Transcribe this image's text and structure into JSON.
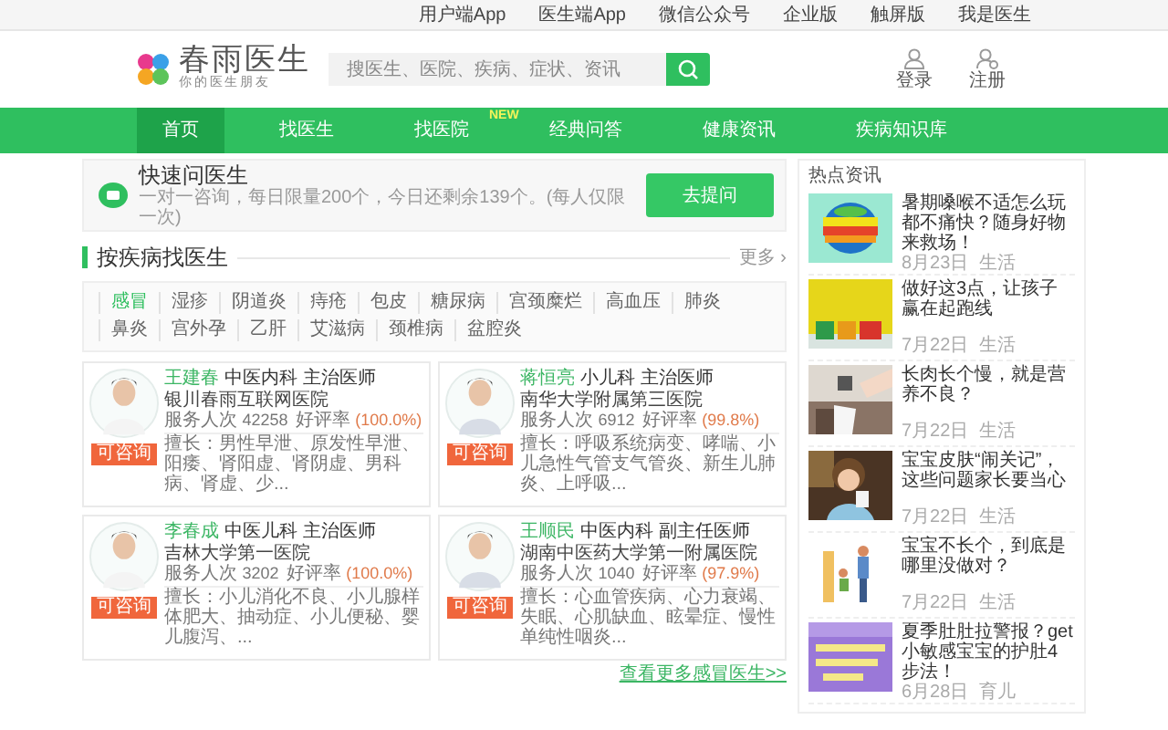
{
  "top_links": [
    "用户端App",
    "医生端App",
    "微信公众号",
    "企业版",
    "触屏版",
    "我是医生"
  ],
  "logo": {
    "name": "春雨医生",
    "tagline": "你的医生朋友"
  },
  "search": {
    "placeholder": "搜医生、医院、疾病、症状、资讯"
  },
  "user_links": [
    {
      "kind": "login",
      "label": "登录"
    },
    {
      "kind": "register",
      "label": "注册"
    }
  ],
  "nav": [
    {
      "label": "首页",
      "selected": true
    },
    {
      "label": "找医生",
      "selected": false
    },
    {
      "label": "找医院",
      "selected": false,
      "badge": "NEW"
    },
    {
      "label": "经典问答",
      "selected": false
    },
    {
      "label": "健康资讯",
      "selected": false
    },
    {
      "label": "疾病知识库",
      "selected": false
    }
  ],
  "quick_ask": {
    "title": "快速问医生",
    "subtitle": "一对一咨询，每日限量200个，今日还剩余139个。(每人仅限一次)",
    "button": "去提问"
  },
  "disease_section": {
    "title": "按疾病找医生",
    "more": "更多 ›",
    "tags": [
      {
        "label": "感冒",
        "selected": true
      },
      {
        "label": "湿疹",
        "selected": false
      },
      {
        "label": "阴道炎",
        "selected": false
      },
      {
        "label": "痔疮",
        "selected": false
      },
      {
        "label": "包皮",
        "selected": false
      },
      {
        "label": "糖尿病",
        "selected": false
      },
      {
        "label": "宫颈糜烂",
        "selected": false
      },
      {
        "label": "高血压",
        "selected": false
      },
      {
        "label": "肺炎",
        "selected": false
      },
      {
        "label": "鼻炎",
        "selected": false
      },
      {
        "label": "宫外孕",
        "selected": false
      },
      {
        "label": "乙肝",
        "selected": false
      },
      {
        "label": "艾滋病",
        "selected": false
      },
      {
        "label": "颈椎病",
        "selected": false
      },
      {
        "label": "盆腔炎",
        "selected": false
      }
    ]
  },
  "doctors": [
    {
      "name": "王建春",
      "department": "中医内科",
      "title": "主治医师",
      "hospital": "银川春雨互联网医院",
      "service_label": "服务人次",
      "service_count": "42258",
      "rating_label": "好评率",
      "rating": "(100.0%)",
      "specialty": "擅长：男性早泄、原发性早泄、阳痿、肾阳虚、肾阴虚、男科病、肾虚、少...",
      "badge": "可咨询"
    },
    {
      "name": "蒋恒亮",
      "department": "小儿科",
      "title": "主治医师",
      "hospital": "南华大学附属第三医院",
      "service_label": "服务人次",
      "service_count": "6912",
      "rating_label": "好评率",
      "rating": "(99.8%)",
      "specialty": "擅长：呼吸系统病变、哮喘、小儿急性气管支气管炎、新生儿肺炎、上呼吸...",
      "badge": "可咨询"
    },
    {
      "name": "李春成",
      "department": "中医儿科",
      "title": "主治医师",
      "hospital": "吉林大学第一医院",
      "service_label": "服务人次",
      "service_count": "3202",
      "rating_label": "好评率",
      "rating": "(100.0%)",
      "specialty": "擅长：小儿消化不良、小儿腺样体肥大、抽动症、小儿便秘、婴儿腹泻、...",
      "badge": "可咨询"
    },
    {
      "name": "王顺民",
      "department": "中医内科",
      "title": "副主任医师",
      "hospital": "湖南中医药大学第一附属医院",
      "service_label": "服务人次",
      "service_count": "1040",
      "rating_label": "好评率",
      "rating": "(97.9%)",
      "specialty": "擅长：心血管疾病、心力衰竭、失眠、心肌缺血、眩晕症、慢性单纯性咽炎...",
      "badge": "可咨询"
    }
  ],
  "more_doctors": "查看更多感冒医生>>",
  "hot_news": {
    "title": "热点资讯",
    "items": [
      {
        "title": "暑期嗓喉不适怎么玩都不痛快？随身好物来救场！",
        "date": "8月23日",
        "category": "生活"
      },
      {
        "title": "做好这3点，让孩子赢在起跑线",
        "date": "7月22日",
        "category": "生活"
      },
      {
        "title": "长肉长个慢，就是营养不良？",
        "date": "7月22日",
        "category": "生活"
      },
      {
        "title": "宝宝皮肤“闹关记”，这些问题家长要当心",
        "date": "7月22日",
        "category": "生活"
      },
      {
        "title": "宝宝不长个，到底是哪里没做对？",
        "date": "7月22日",
        "category": "生活"
      },
      {
        "title": "夏季肚肚拉警报？get小敏感宝宝的护肚4步法！",
        "date": "6月28日",
        "category": "育儿"
      }
    ]
  }
}
